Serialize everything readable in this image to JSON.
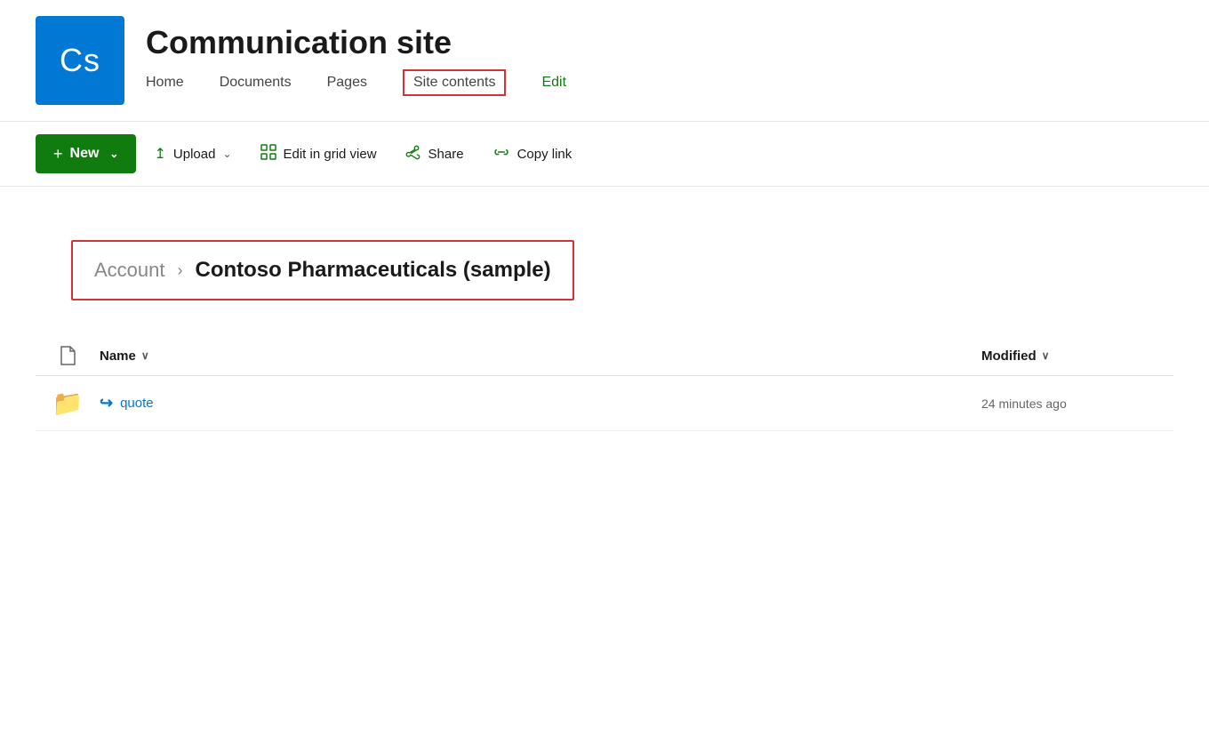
{
  "site": {
    "logo_text": "Cs",
    "title": "Communication site",
    "logo_bg": "#0078d4"
  },
  "nav": {
    "items": [
      {
        "label": "Home",
        "id": "home",
        "highlighted": false
      },
      {
        "label": "Documents",
        "id": "documents",
        "highlighted": false
      },
      {
        "label": "Pages",
        "id": "pages",
        "highlighted": false
      },
      {
        "label": "Site contents",
        "id": "site-contents",
        "highlighted": true
      },
      {
        "label": "Edit",
        "id": "edit",
        "highlighted": false,
        "is_edit": true
      }
    ]
  },
  "toolbar": {
    "new_label": "New",
    "upload_label": "Upload",
    "edit_grid_label": "Edit in grid view",
    "share_label": "Share",
    "copy_link_label": "Copy link"
  },
  "breadcrumb": {
    "parent": "Account",
    "separator": "›",
    "current": "Contoso Pharmaceuticals (sample)"
  },
  "file_list": {
    "col_name": "Name",
    "col_modified": "Modified",
    "sort_icon": "∨",
    "files": [
      {
        "name": "quote",
        "type": "folder",
        "modified": "24 minutes ago",
        "syncing": true
      }
    ]
  }
}
